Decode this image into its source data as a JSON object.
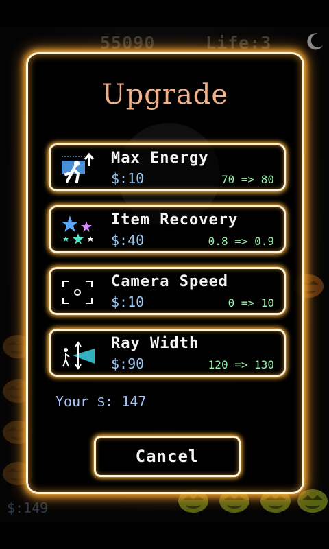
{
  "hud": {
    "score": "55090",
    "life": "Life:3",
    "money": "$:149"
  },
  "dialog": {
    "title": "Upgrade",
    "upgrades": [
      {
        "name": "Max Energy",
        "price": "$:10",
        "change": "70 => 80",
        "icon": "running-man-arrow-icon"
      },
      {
        "name": "Item Recovery",
        "price": "$:40",
        "change": "0.8 => 0.9",
        "icon": "stars-icon"
      },
      {
        "name": "Camera Speed",
        "price": "$:10",
        "change": "0 => 10",
        "icon": "camera-frame-icon"
      },
      {
        "name": "Ray Width",
        "price": "$:90",
        "change": "120 => 130",
        "icon": "ray-width-icon"
      }
    ],
    "your_money": "Your $: 147",
    "cancel_label": "Cancel"
  },
  "colors": {
    "glow": "#ffb338",
    "border": "#fff4da",
    "title": "#f0b08a",
    "price": "#9bc7f2",
    "change": "#9bf0b0",
    "your_money": "#a9c6ff"
  }
}
